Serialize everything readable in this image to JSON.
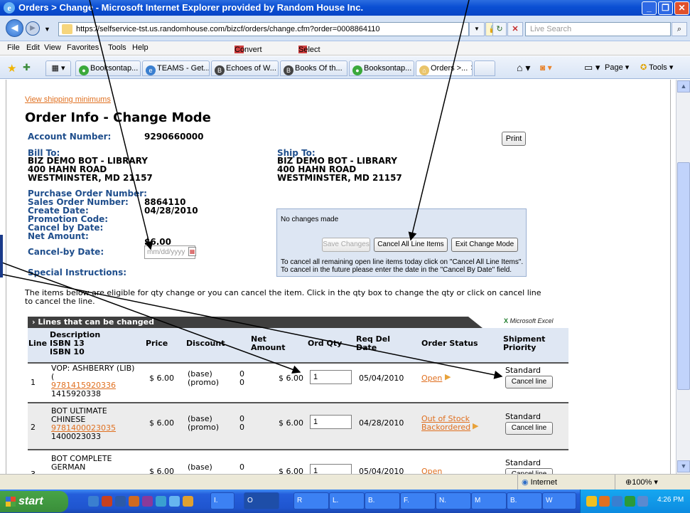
{
  "window": {
    "title": "Orders > Change - Microsoft Internet Explorer provided by Random House Inc.",
    "minimize": "_",
    "maximize": "❐",
    "close": "✕"
  },
  "address": {
    "url": "https://selfservice-tst.us.randomhouse.com/bizcf/orders/change.cfm?order=0008864110",
    "search_placeholder": "Live Search"
  },
  "menu": [
    "File",
    "Edit",
    "View",
    "Favorites",
    "Tools",
    "Help"
  ],
  "toolbar_links": {
    "convert": "Convert",
    "select": "Select"
  },
  "tabs": [
    {
      "label": "Booksontap..."
    },
    {
      "label": "TEAMS - Get..."
    },
    {
      "label": "Echoes of W..."
    },
    {
      "label": "Books Of th..."
    },
    {
      "label": "Booksontap..."
    },
    {
      "label": "Orders >..."
    }
  ],
  "tab_tools": {
    "page": "Page",
    "tools": "Tools"
  },
  "order": {
    "shipping_link": "View shipping minimums",
    "heading": "Order Info - Change Mode",
    "account_label": "Account Number:",
    "account_value": "9290660000",
    "print": "Print",
    "bill_to_label": "Bill To:",
    "bill_to": [
      "BIZ DEMO BOT - LIBRARY",
      "400 HAHN ROAD",
      "WESTMINSTER, MD 21157"
    ],
    "ship_to_label": "Ship To:",
    "ship_to": [
      "BIZ DEMO BOT - LIBRARY",
      "400 HAHN ROAD",
      "WESTMINSTER, MD 21157"
    ],
    "po_label": "Purchase Order Number:",
    "so_label": "Sales Order Number:",
    "so_value": "8864110",
    "create_label": "Create Date:",
    "create_value": "04/28/2010",
    "promo_label": "Promotion Code:",
    "cancel_by_label": "Cancel by Date:",
    "net_label": "Net Amount:",
    "net_value": "$6.00",
    "cancel_by_date_label": "Cancel-by Date:",
    "cancel_by_placeholder": "mm/dd/yyyy",
    "special_label": "Special Instructions:",
    "change_box": {
      "message": "No changes made",
      "save": "Save Changes",
      "cancel_all": "Cancel All Line Items",
      "exit": "Exit Change Mode",
      "note1": "To cancel all remaining open line items today click on \"Cancel All Line Items\".",
      "note2": "To cancel in the future please enter the date in the \"Cancel By Date\" field."
    },
    "eligible_text": "The items below are eligible for qty change or you can cancel the item. Click in the qty box to change the qty or click on cancel line to cancel the line."
  },
  "lines": {
    "title": "Lines that can be changed",
    "excel": "Microsoft Excel",
    "headers": {
      "line": "Line",
      "desc": [
        "Description",
        "ISBN 13",
        "ISBN 10"
      ],
      "price": "Price",
      "discount": "Discount",
      "net": [
        "Net",
        "Amount"
      ],
      "ordqty": "Ord Qty",
      "reqdel": [
        "Req Del",
        "Date"
      ],
      "status": "Order Status",
      "priority": [
        "Shipment",
        "Priority"
      ]
    },
    "rows": [
      {
        "line": "1",
        "desc": [
          "VOP: ASHBERRY (LIB)",
          "("
        ],
        "isbn13": "9781415920336",
        "isbn10": "1415920338",
        "price": "$ 6.00",
        "disc_base": "(base)",
        "disc_promo": "(promo)",
        "disc_base_val": "0",
        "disc_promo_val": "0",
        "net": "$ 6.00",
        "qty": "1",
        "req": "05/04/2010",
        "status": [
          "Open"
        ],
        "priority": "Standard",
        "cancel": "Cancel line"
      },
      {
        "line": "2",
        "desc": [
          "BOT ULTIMATE",
          "CHINESE"
        ],
        "isbn13": "9781400023035",
        "isbn10": "1400023033",
        "price": "$ 6.00",
        "disc_base": "(base)",
        "disc_promo": "(promo)",
        "disc_base_val": "0",
        "disc_promo_val": "0",
        "net": "$ 6.00",
        "qty": "1",
        "req": "04/28/2010",
        "status": [
          "Out of Stock",
          "Backordered"
        ],
        "priority": "Standard",
        "cancel": "Cancel line"
      },
      {
        "line": "3",
        "desc": [
          "BOT COMPLETE",
          "GERMAN"
        ],
        "price": "$ 6.00",
        "disc_base": "(base)",
        "disc_base_val": "0",
        "net": "$ 6.00",
        "qty": "1",
        "req": "05/04/2010",
        "status": [
          "Open"
        ],
        "priority": "Standard",
        "cancel": "Cancel line"
      }
    ]
  },
  "statusbar": {
    "zone": "Internet",
    "zoom": "100%"
  },
  "taskbar": {
    "start": "start",
    "tasks": [
      "I.",
      "O",
      "R",
      "L.",
      "B.",
      "F.",
      "N.",
      "M",
      "B.",
      "W"
    ],
    "clock": "4:26 PM"
  }
}
